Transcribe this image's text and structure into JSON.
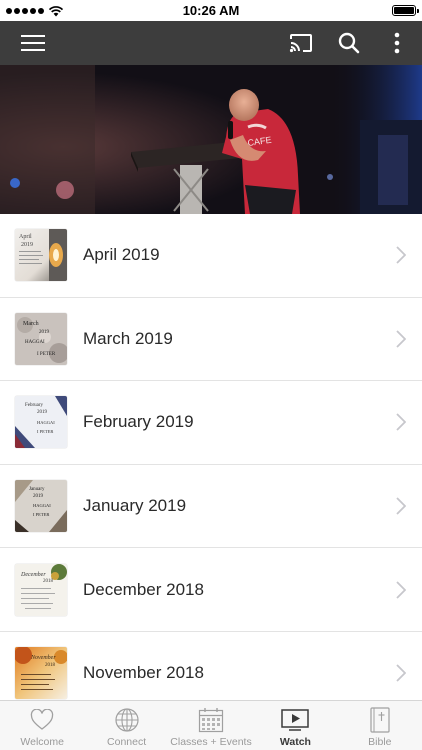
{
  "status_bar": {
    "time": "10:26 AM"
  },
  "top_nav": {
    "menu_icon": "hamburger-menu-icon",
    "cast_icon": "cast-icon",
    "search_icon": "search-icon",
    "more_icon": "more-vertical-icon",
    "bar_color": "#3d3d3d"
  },
  "hero": {
    "icon": "preacher-photo",
    "shirt_text": "CAFE"
  },
  "series_list": {
    "items": [
      {
        "label": "April 2019",
        "thumb": {
          "lines": [
            "April",
            "2019"
          ]
        }
      },
      {
        "label": "March 2019",
        "thumb": {
          "lines": [
            "March",
            "2019",
            "HAGGAI",
            "I PETER"
          ]
        }
      },
      {
        "label": "February 2019",
        "thumb": {
          "lines": [
            "February",
            "2019",
            "HAGGAI",
            "I PETER"
          ]
        }
      },
      {
        "label": "January 2019",
        "thumb": {
          "lines": [
            "January",
            "2019",
            "HAGGAI",
            "I PETER"
          ]
        }
      },
      {
        "label": "December 2018",
        "thumb": {
          "lines": [
            "December",
            "2018"
          ]
        }
      },
      {
        "label": "November 2018",
        "thumb": {
          "lines": [
            "November",
            "2018"
          ]
        }
      }
    ]
  },
  "tab_bar": {
    "tabs": [
      {
        "label": "Welcome",
        "icon": "heart-icon",
        "active": false
      },
      {
        "label": "Connect",
        "icon": "globe-icon",
        "active": false
      },
      {
        "label": "Classes + Events",
        "icon": "calendar-icon",
        "active": false
      },
      {
        "label": "Watch",
        "icon": "play-video-icon",
        "active": true
      },
      {
        "label": "Bible",
        "icon": "bible-icon",
        "active": false
      }
    ],
    "active_color": "#3a3a3a",
    "inactive_color": "#9a9a9a"
  }
}
